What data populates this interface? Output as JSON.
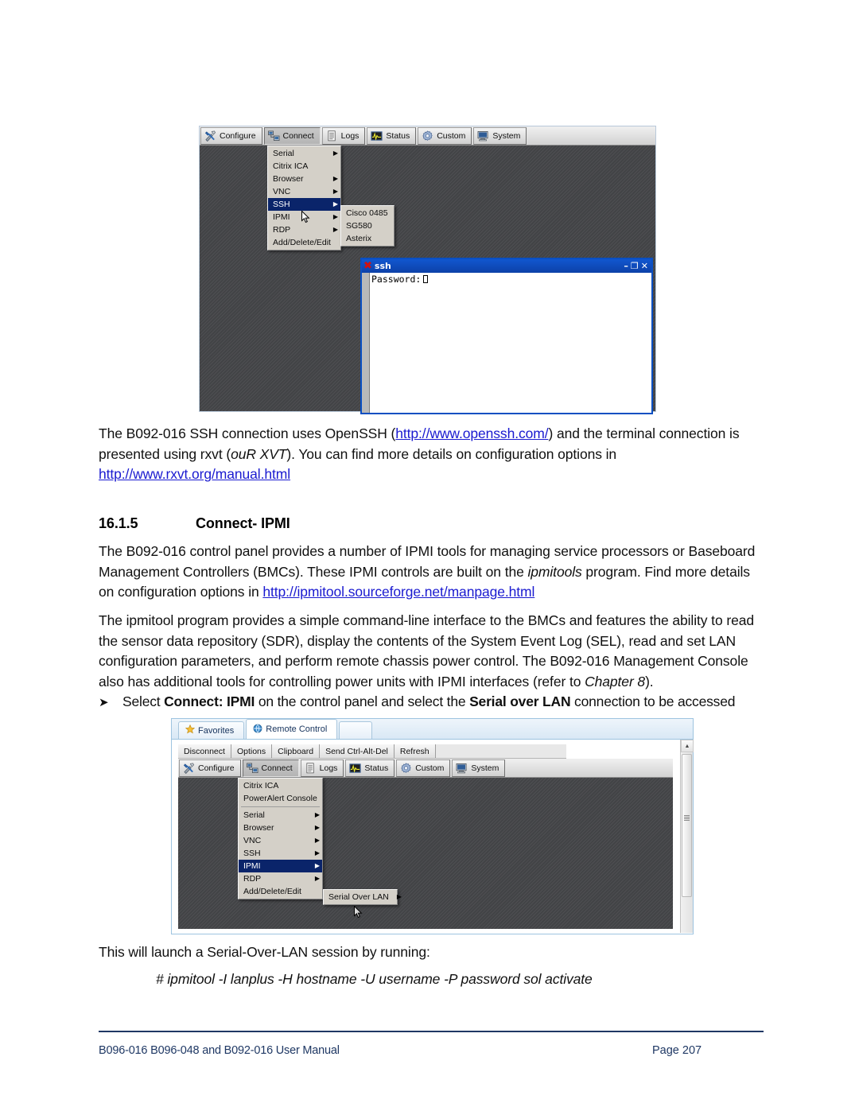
{
  "document": {
    "paragraphs": {
      "p1_pre": "The B092-016 SSH connection uses OpenSSH (",
      "p1_link1": "http://www.openssh.com/",
      "p1_mid": ") and the terminal connection is presented using rxvt (",
      "p1_italic": "ouR XVT",
      "p1_post": "). You can find more details on configuration options in ",
      "p1_link2": "http://www.rxvt.org/manual.html",
      "p2_pre": "The B092-016 control panel provides a number of IPMI tools for managing service processors or Baseboard Management Controllers (BMCs). These IPMI controls are built on the ",
      "p2_italic": "ipmitools",
      "p2_mid": " program. Find more details on configuration options in ",
      "p2_link": "http://ipmitool.sourceforge.net/manpage.html",
      "p3": "The ipmitool program provides a simple command-line interface to the BMCs and features the ability to read the sensor data repository (SDR),  display the contents of the System Event Log (SEL), read and set LAN configuration parameters, and perform remote chassis power control. The B092-016 Management Console also has additional tools for controlling power units with IPMI interfaces (refer to ",
      "p3_italic": "Chapter 8",
      "p3_post": ").",
      "bullet_arrow": "➤",
      "bullet_pre": "Select ",
      "bullet_bold1": "Connect: IPMI",
      "bullet_mid": " on the control panel and select the ",
      "bullet_bold2": "Serial over LAN",
      "bullet_post": " connection to be accessed",
      "p4": "This will launch a Serial-Over-LAN session by running:",
      "code": "# ipmitool -I lanplus -H hostname -U username -P password sol activate"
    },
    "heading": {
      "number": "16.1.5",
      "title": "Connect- IPMI"
    },
    "footer": {
      "left": "B096-016 B096-048 and B092-016 User Manual",
      "right": "Page 207"
    }
  },
  "screenshot1": {
    "toolbar": [
      {
        "label": "Configure",
        "icon": "screwdriver-wrench-icon",
        "pressed": false
      },
      {
        "label": "Connect",
        "icon": "network-computers-icon",
        "pressed": true
      },
      {
        "label": "Logs",
        "icon": "document-lines-icon",
        "pressed": false
      },
      {
        "label": "Status",
        "icon": "waveform-monitor-icon",
        "pressed": false
      },
      {
        "label": "Custom",
        "icon": "gear-icon",
        "pressed": false
      },
      {
        "label": "System",
        "icon": "monitor-icon",
        "pressed": false
      }
    ],
    "connect_menu": [
      {
        "label": "Serial",
        "submenu": true,
        "selected": false
      },
      {
        "label": "Citrix ICA",
        "submenu": false,
        "selected": false
      },
      {
        "label": "Browser",
        "submenu": true,
        "selected": false
      },
      {
        "label": "VNC",
        "submenu": true,
        "selected": false
      },
      {
        "label": "SSH",
        "submenu": true,
        "selected": true
      },
      {
        "label": "IPMI",
        "submenu": true,
        "selected": false
      },
      {
        "label": "RDP",
        "submenu": true,
        "selected": false
      },
      {
        "label": "Add/Delete/Edit",
        "submenu": false,
        "selected": false
      }
    ],
    "ssh_submenu": [
      "Cisco 0485",
      "SG580",
      "Asterix"
    ],
    "terminal": {
      "title": "ssh",
      "title_icon": "x-logo-icon",
      "prompt": "Password:",
      "minimize": "–",
      "maximize": "❐",
      "close": "✕"
    }
  },
  "screenshot2": {
    "browser_tabs": [
      {
        "label": "Favorites",
        "icon": "star-icon",
        "active": false
      },
      {
        "label": "Remote Control",
        "icon": "globe-icon",
        "active": true
      }
    ],
    "mini_toolbar": [
      "Disconnect",
      "Options",
      "Clipboard",
      "Send Ctrl-Alt-Del",
      "Refresh"
    ],
    "toolbar": [
      {
        "label": "Configure",
        "icon": "screwdriver-wrench-icon",
        "pressed": false
      },
      {
        "label": "Connect",
        "icon": "network-computers-icon",
        "pressed": true
      },
      {
        "label": "Logs",
        "icon": "document-lines-icon",
        "pressed": false
      },
      {
        "label": "Status",
        "icon": "waveform-monitor-icon",
        "pressed": false
      },
      {
        "label": "Custom",
        "icon": "gear-icon",
        "pressed": false
      },
      {
        "label": "System",
        "icon": "monitor-icon",
        "pressed": false
      }
    ],
    "connect_menu": [
      {
        "label": "Citrix ICA",
        "submenu": false,
        "selected": false,
        "sep_after": false
      },
      {
        "label": "PowerAlert Console",
        "submenu": false,
        "selected": false,
        "sep_after": true
      },
      {
        "label": "Serial",
        "submenu": true,
        "selected": false,
        "sep_after": false
      },
      {
        "label": "Browser",
        "submenu": true,
        "selected": false,
        "sep_after": false
      },
      {
        "label": "VNC",
        "submenu": true,
        "selected": false,
        "sep_after": false
      },
      {
        "label": "SSH",
        "submenu": true,
        "selected": false,
        "sep_after": false
      },
      {
        "label": "IPMI",
        "submenu": true,
        "selected": true,
        "sep_after": false
      },
      {
        "label": "RDP",
        "submenu": true,
        "selected": false,
        "sep_after": false
      },
      {
        "label": "Add/Delete/Edit",
        "submenu": false,
        "selected": false,
        "sep_after": false
      }
    ],
    "ipmi_submenu": [
      {
        "label": "Serial Over LAN",
        "submenu": true
      }
    ]
  },
  "colors": {
    "link": "#1a1ad0",
    "footer": "#1f3864",
    "menu_highlight": "#0a246a",
    "titlebar": "#1157cf",
    "desktop": "#46474a"
  }
}
